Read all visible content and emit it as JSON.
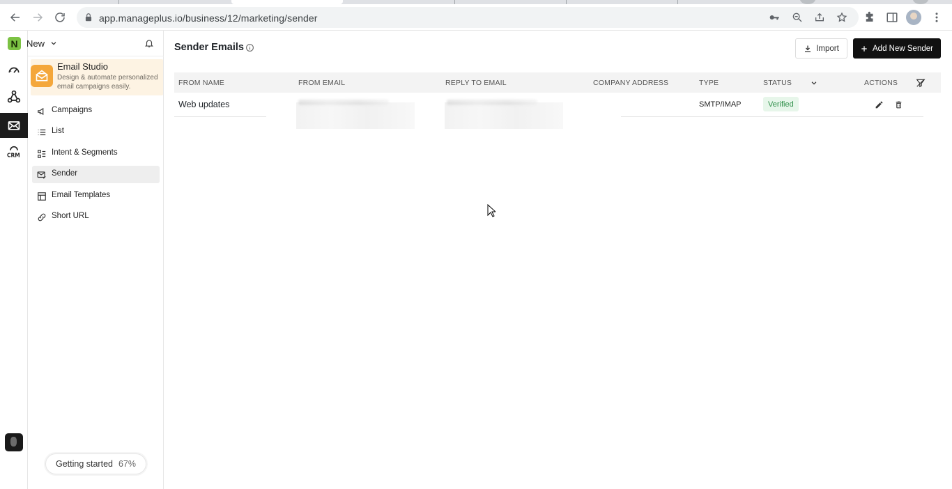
{
  "browser": {
    "url": "app.manageplus.io/business/12/marketing/sender"
  },
  "workspace": {
    "name": "New",
    "logo_letter": "N"
  },
  "studio": {
    "title": "Email Studio",
    "description": "Design & automate personalized email campaigns easily.",
    "accent_color": "#f4a73b"
  },
  "nav": {
    "items": [
      {
        "label": "Campaigns",
        "icon": "megaphone-icon"
      },
      {
        "label": "List",
        "icon": "list-icon"
      },
      {
        "label": "Intent & Segments",
        "icon": "segments-icon"
      },
      {
        "label": "Sender",
        "icon": "envelope-edit-icon",
        "active": true
      },
      {
        "label": "Email Templates",
        "icon": "template-icon"
      },
      {
        "label": "Short URL",
        "icon": "link-icon"
      }
    ]
  },
  "getting_started": {
    "label": "Getting started",
    "percent": "67%"
  },
  "page": {
    "title": "Sender Emails",
    "import_label": "Import",
    "add_label": "Add New Sender"
  },
  "table": {
    "columns": [
      "FROM NAME",
      "FROM EMAIL",
      "REPLY TO EMAIL",
      "COMPANY ADDRESS",
      "TYPE",
      "STATUS",
      "ACTIONS"
    ],
    "rows": [
      {
        "from_name": "Web updates",
        "from_email": "",
        "reply_to_email": "",
        "company_address": "",
        "type": "SMTP/IMAP",
        "status": "Verified"
      }
    ],
    "status_color": "#2f8f49"
  }
}
